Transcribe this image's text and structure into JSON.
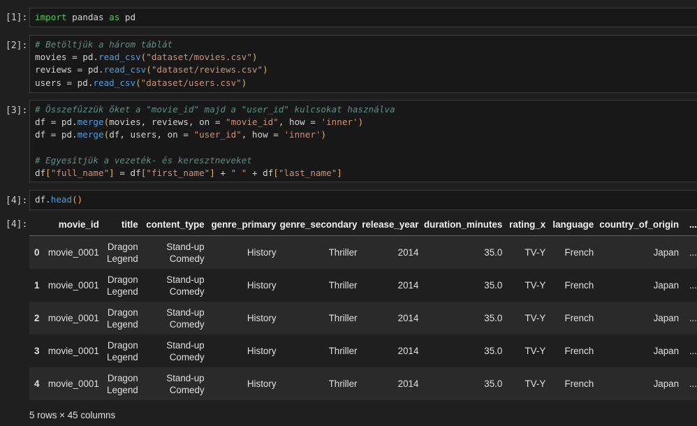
{
  "cells": [
    {
      "prompt": "[1]:",
      "lines": [
        [
          {
            "t": "kw",
            "v": "import"
          },
          {
            "t": "op",
            "v": " pandas "
          },
          {
            "t": "kw",
            "v": "as"
          },
          {
            "t": "op",
            "v": " pd"
          }
        ]
      ]
    },
    {
      "prompt": "[2]:",
      "lines": [
        [
          {
            "t": "cm",
            "v": "# Betöltjük a három táblát"
          }
        ],
        [
          {
            "t": "op",
            "v": "movies = pd."
          },
          {
            "t": "fn",
            "v": "read_csv"
          },
          {
            "t": "br",
            "v": "("
          },
          {
            "t": "str",
            "v": "\"dataset/movies.csv\""
          },
          {
            "t": "br",
            "v": ")"
          }
        ],
        [
          {
            "t": "op",
            "v": "reviews = pd."
          },
          {
            "t": "fn",
            "v": "read_csv"
          },
          {
            "t": "br",
            "v": "("
          },
          {
            "t": "str",
            "v": "\"dataset/reviews.csv\""
          },
          {
            "t": "br",
            "v": ")"
          }
        ],
        [
          {
            "t": "op",
            "v": "users = pd."
          },
          {
            "t": "fn",
            "v": "read_csv"
          },
          {
            "t": "br",
            "v": "("
          },
          {
            "t": "str",
            "v": "\"dataset/users.csv\""
          },
          {
            "t": "br",
            "v": ")"
          }
        ]
      ]
    },
    {
      "prompt": "[3]:",
      "lines": [
        [
          {
            "t": "cm",
            "v": "# Összefűzzük őket a \"movie_id\" majd a \"user_id\" kulcsokat használva"
          }
        ],
        [
          {
            "t": "op",
            "v": "df = pd."
          },
          {
            "t": "fn",
            "v": "merge"
          },
          {
            "t": "br",
            "v": "("
          },
          {
            "t": "op",
            "v": "movies, reviews, on = "
          },
          {
            "t": "str",
            "v": "\"movie_id\""
          },
          {
            "t": "op",
            "v": ", how = "
          },
          {
            "t": "sq",
            "v": "'inner'"
          },
          {
            "t": "br",
            "v": ")"
          }
        ],
        [
          {
            "t": "op",
            "v": "df = pd."
          },
          {
            "t": "fn",
            "v": "merge"
          },
          {
            "t": "br",
            "v": "("
          },
          {
            "t": "op",
            "v": "df, users, on = "
          },
          {
            "t": "str",
            "v": "\"user_id\""
          },
          {
            "t": "op",
            "v": ", how = "
          },
          {
            "t": "sq",
            "v": "'inner'"
          },
          {
            "t": "br",
            "v": ")"
          }
        ],
        [],
        [
          {
            "t": "cm",
            "v": "# Egyesítjük a vezeték- és keresztneveket"
          }
        ],
        [
          {
            "t": "op",
            "v": "df"
          },
          {
            "t": "br",
            "v": "["
          },
          {
            "t": "str",
            "v": "\"full_name\""
          },
          {
            "t": "br",
            "v": "]"
          },
          {
            "t": "op",
            "v": " = df"
          },
          {
            "t": "br",
            "v": "["
          },
          {
            "t": "str",
            "v": "\"first_name\""
          },
          {
            "t": "br",
            "v": "]"
          },
          {
            "t": "op",
            "v": " + "
          },
          {
            "t": "str",
            "v": "\" \""
          },
          {
            "t": "op",
            "v": " + df"
          },
          {
            "t": "br",
            "v": "["
          },
          {
            "t": "str",
            "v": "\"last_name\""
          },
          {
            "t": "br",
            "v": "]"
          }
        ]
      ]
    },
    {
      "prompt": "[4]:",
      "lines": [
        [
          {
            "t": "op",
            "v": "df."
          },
          {
            "t": "fn",
            "v": "head"
          },
          {
            "t": "br",
            "v": "()"
          }
        ]
      ]
    }
  ],
  "output": {
    "prompt": "[4]:",
    "columns": [
      "",
      "movie_id",
      "title",
      "content_type",
      "genre_primary",
      "genre_secondary",
      "release_year",
      "duration_minutes",
      "rating_x",
      "language",
      "country_of_origin",
      "..."
    ],
    "rows": [
      [
        "0",
        "movie_0001",
        [
          "Dragon",
          "Legend"
        ],
        [
          "Stand-up",
          "Comedy"
        ],
        "History",
        "Thriller",
        "2014",
        "35.0",
        "TV-Y",
        "French",
        "Japan",
        "..."
      ],
      [
        "1",
        "movie_0001",
        [
          "Dragon",
          "Legend"
        ],
        [
          "Stand-up",
          "Comedy"
        ],
        "History",
        "Thriller",
        "2014",
        "35.0",
        "TV-Y",
        "French",
        "Japan",
        "..."
      ],
      [
        "2",
        "movie_0001",
        [
          "Dragon",
          "Legend"
        ],
        [
          "Stand-up",
          "Comedy"
        ],
        "History",
        "Thriller",
        "2014",
        "35.0",
        "TV-Y",
        "French",
        "Japan",
        "..."
      ],
      [
        "3",
        "movie_0001",
        [
          "Dragon",
          "Legend"
        ],
        [
          "Stand-up",
          "Comedy"
        ],
        "History",
        "Thriller",
        "2014",
        "35.0",
        "TV-Y",
        "French",
        "Japan",
        "..."
      ],
      [
        "4",
        "movie_0001",
        [
          "Dragon",
          "Legend"
        ],
        [
          "Stand-up",
          "Comedy"
        ],
        "History",
        "Thriller",
        "2014",
        "35.0",
        "TV-Y",
        "French",
        "Japan",
        "..."
      ]
    ],
    "footer": "5 rows × 45 columns"
  }
}
